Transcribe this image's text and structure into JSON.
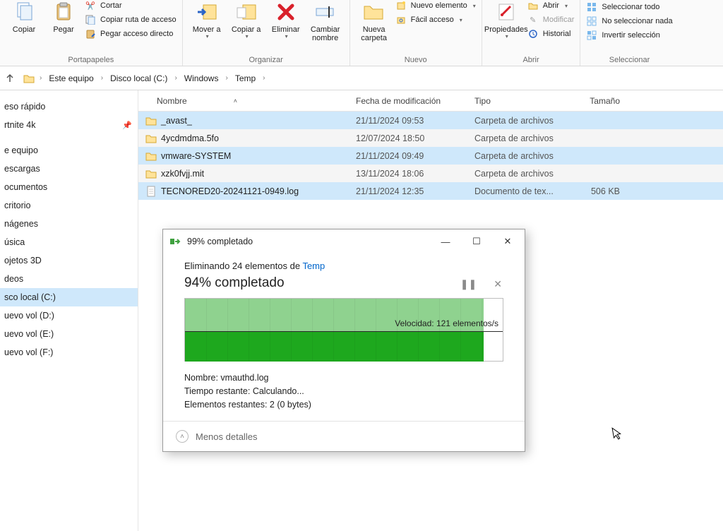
{
  "ribbon": {
    "clipboard": {
      "copy": "Copiar",
      "paste": "Pegar",
      "cut": "Cortar",
      "copy_path": "Copiar ruta de acceso",
      "paste_shortcut": "Pegar acceso directo",
      "group": "Portapapeles"
    },
    "organize": {
      "move": "Mover a",
      "copy": "Copiar a",
      "delete": "Eliminar",
      "rename": "Cambiar nombre",
      "group": "Organizar"
    },
    "new": {
      "new_folder": "Nueva carpeta",
      "new_item": "Nuevo elemento",
      "easy_access": "Fácil acceso",
      "group": "Nuevo"
    },
    "open": {
      "properties": "Propiedades",
      "open": "Abrir",
      "edit": "Modificar",
      "history": "Historial",
      "group": "Abrir"
    },
    "select": {
      "all": "Seleccionar todo",
      "none": "No seleccionar nada",
      "invert": "Invertir selección",
      "group": "Seleccionar"
    }
  },
  "breadcrumb": {
    "seg1": "Este equipo",
    "seg2": "Disco local (C:)",
    "seg3": "Windows",
    "seg4": "Temp"
  },
  "sidebar": {
    "quick": "eso rápido",
    "fortnite": "rtnite 4k",
    "equipo": "e equipo",
    "descargas": "escargas",
    "documentos": "ocumentos",
    "escritorio": "critorio",
    "imagenes": "nágenes",
    "musica": "úsica",
    "objetos": "ojetos 3D",
    "videos": "deos",
    "localc": "sco local (C:)",
    "vold": "uevo vol (D:)",
    "vole": "uevo vol (E:)",
    "volf": "uevo vol (F:)"
  },
  "columns": {
    "name": "Nombre",
    "date": "Fecha de modificación",
    "type": "Tipo",
    "size": "Tamaño"
  },
  "rows": [
    {
      "name": "_avast_",
      "date": "21/11/2024 09:53",
      "type": "Carpeta de archivos",
      "size": "",
      "icon": "folder",
      "sel": true
    },
    {
      "name": "4ycdmdma.5fo",
      "date": "12/07/2024 18:50",
      "type": "Carpeta de archivos",
      "size": "",
      "icon": "folder",
      "sel": false
    },
    {
      "name": "vmware-SYSTEM",
      "date": "21/11/2024 09:49",
      "type": "Carpeta de archivos",
      "size": "",
      "icon": "folder",
      "sel": true
    },
    {
      "name": "xzk0fvjj.mit",
      "date": "13/11/2024 18:06",
      "type": "Carpeta de archivos",
      "size": "",
      "icon": "folder",
      "sel": false
    },
    {
      "name": "TECNORED20-20241121-0949.log",
      "date": "21/11/2024 12:35",
      "type": "Documento de tex...",
      "size": "506 KB",
      "icon": "file",
      "sel": true
    }
  ],
  "dialog": {
    "title": "99% completado",
    "action_prefix": "Eliminando 24 elementos de ",
    "action_link": "Temp",
    "percent": "94% completado",
    "speed": "Velocidad: 121 elementos/s",
    "info_name_label": "Nombre: ",
    "info_name_value": "vmauthd.log",
    "info_time_label": "Tiempo restante: ",
    "info_time_value": "Calculando...",
    "info_items_label": "Elementos restantes: ",
    "info_items_value": "2 (0 bytes)",
    "footer": "Menos detalles",
    "progress_top_pct": 94,
    "progress_bottom_pct": 94
  }
}
